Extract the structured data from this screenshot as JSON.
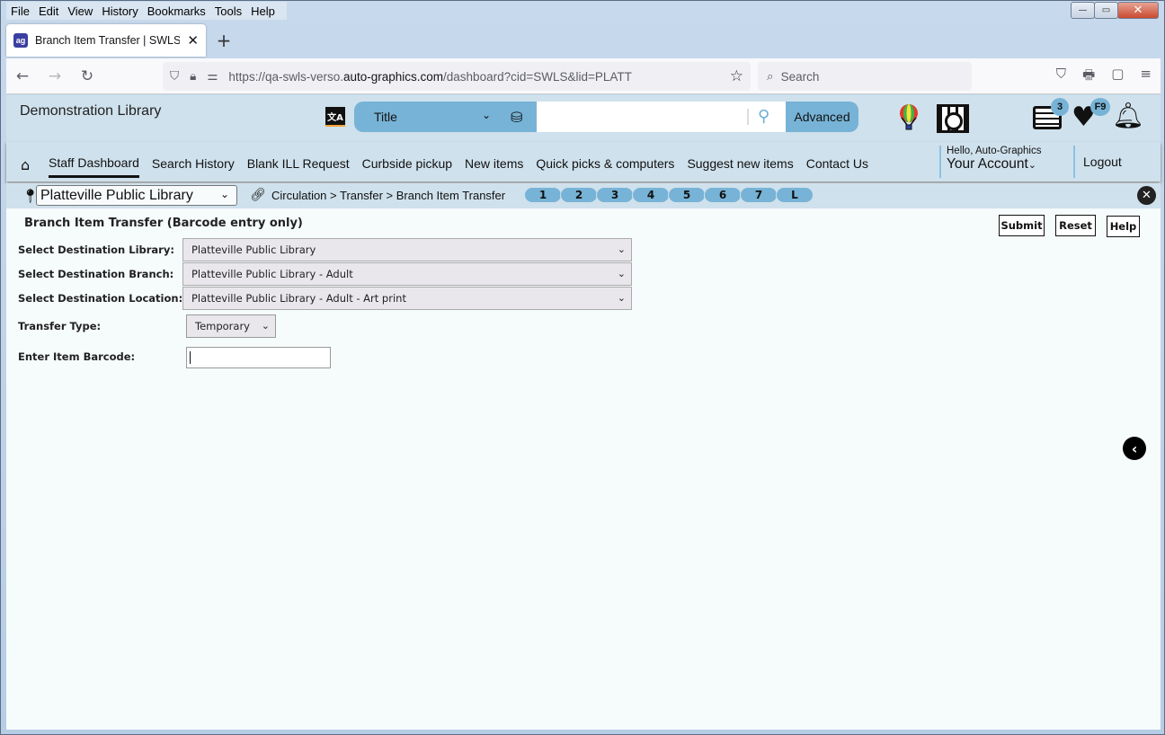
{
  "browser": {
    "menu": [
      "File",
      "Edit",
      "View",
      "History",
      "Bookmarks",
      "Tools",
      "Help"
    ],
    "tab": {
      "title": "Branch Item Transfer | SWLS | pl",
      "favicon": "auto-graphics-logo"
    },
    "url": {
      "prefix": "https://qa-swls-verso.",
      "domain": "auto-graphics.com",
      "path": "/dashboard?cid=SWLS&lid=PLATT"
    },
    "search_placeholder": "Search",
    "icons": {
      "back": "←",
      "forward": "→",
      "reload": "↻",
      "new_tab": "+",
      "close_tab": "✕",
      "star": "☆",
      "search": "🔍",
      "pocket": "⛉",
      "print": "🖶",
      "extension": "▢",
      "menu": "≡",
      "minimize": "—",
      "maximize": "▭",
      "close": "✕"
    }
  },
  "header": {
    "library_name": "Demonstration Library",
    "search": {
      "type": "Title",
      "query": "",
      "advanced_label": "Advanced"
    },
    "badges": {
      "list_count": "3",
      "favorites_key": "F9"
    },
    "nav": [
      "Staff Dashboard",
      "Search History",
      "Blank ILL Request",
      "Curbside pickup",
      "New items",
      "Quick picks & computers",
      "Suggest new items",
      "Contact Us"
    ],
    "active_nav": "Staff Dashboard",
    "account": {
      "hello": "Hello, Auto-Graphics",
      "label": "Your Account"
    },
    "logout_label": "Logout"
  },
  "context": {
    "library_select": "Platteville Public Library",
    "breadcrumb": "Circulation > Transfer > Branch Item Transfer",
    "shortcuts": [
      "1",
      "2",
      "3",
      "4",
      "5",
      "6",
      "7",
      "L"
    ]
  },
  "form": {
    "title": "Branch Item Transfer (Barcode entry only)",
    "buttons": {
      "submit": "Submit",
      "reset": "Reset",
      "help": "Help"
    },
    "fields": {
      "dest_library": {
        "label": "Select Destination Library:",
        "value": "Platteville Public Library"
      },
      "dest_branch": {
        "label": "Select Destination Branch:",
        "value": "Platteville Public Library - Adult"
      },
      "dest_location": {
        "label": "Select Destination Location:",
        "value": "Platteville Public Library - Adult - Art print"
      },
      "transfer_type": {
        "label": "Transfer Type:",
        "value": "Temporary"
      },
      "barcode": {
        "label": "Enter Item Barcode:",
        "value": ""
      }
    }
  }
}
